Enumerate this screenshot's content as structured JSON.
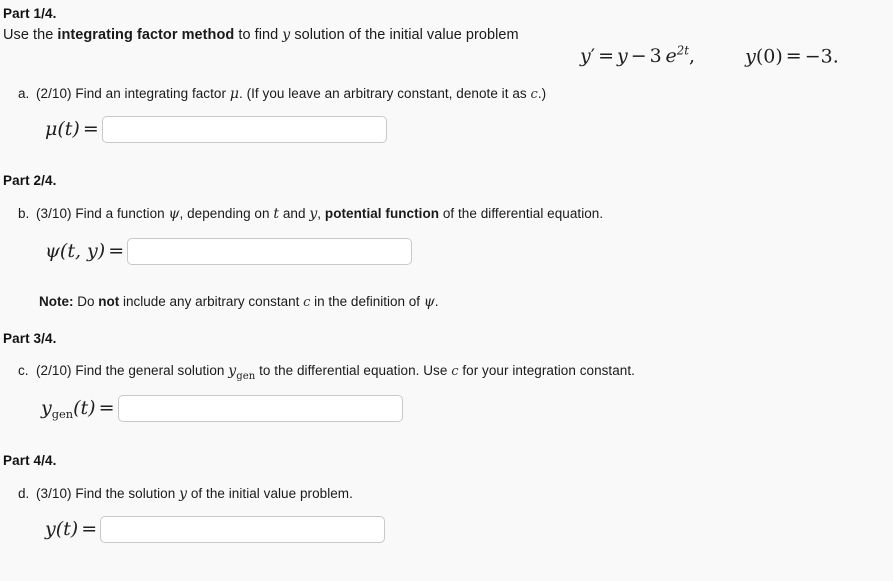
{
  "page": {
    "background_color": "#f9f9f9",
    "text_color": "#1a1a1a"
  },
  "parts": [
    {
      "heading": "Part 1/4.",
      "prompt": {
        "before_bold": "Use the ",
        "bold": "integrating factor method",
        "after_bold": " to find ",
        "math_var": "y",
        "tail": " solution of the initial value problem"
      },
      "equation": {
        "left": "y′ = y − 3 e",
        "exponent": "2t",
        "comma": ",",
        "initial_condition": "y(0) = −3."
      },
      "item": {
        "marker": "a.",
        "points": "(2/10)",
        "text_1": " Find an integrating factor ",
        "math_1": "μ",
        "text_2": ". (If you leave an arbitrary constant, denote it as ",
        "math_2": "c",
        "text_3": ".)"
      },
      "answer": {
        "label_fn": "μ",
        "label_args": "(t)",
        "label_eq": "=",
        "value": "",
        "placeholder": ""
      }
    },
    {
      "heading": "Part 2/4.",
      "item": {
        "marker": "b.",
        "points": "(3/10)",
        "text_1": " Find a function ",
        "math_1": "ψ",
        "text_2": ", depending on ",
        "math_2": "t",
        "text_3": " and ",
        "math_3": "y",
        "text_4": ", ",
        "bold": "potential function",
        "text_5": " of the differential equation."
      },
      "answer": {
        "label_fn": "ψ",
        "label_args": "(t, y)",
        "label_eq": "=",
        "value": "",
        "placeholder": ""
      },
      "note": {
        "label": "Note:",
        "text_1": " Do ",
        "bold": "not",
        "text_2": " include any arbitrary constant ",
        "math_1": "c",
        "text_3": " in the definition of ",
        "math_2": "ψ",
        "text_4": "."
      }
    },
    {
      "heading": "Part 3/4.",
      "item": {
        "marker": "c.",
        "points": "(2/10)",
        "text_1": " Find the general solution ",
        "math_1": "y",
        "math_1_sub": "gen",
        "text_2": " to the differential equation. Use ",
        "math_2": "c",
        "text_3": " for your integration constant."
      },
      "answer": {
        "label_fn": "y",
        "label_sub": "gen",
        "label_args": "(t)",
        "label_eq": "=",
        "value": "",
        "placeholder": ""
      }
    },
    {
      "heading": "Part 4/4.",
      "item": {
        "marker": "d.",
        "points": "(3/10)",
        "text_1": " Find the solution ",
        "math_1": "y",
        "text_2": " of the initial value problem."
      },
      "answer": {
        "label_fn": "y",
        "label_args": "(t)",
        "label_eq": "=",
        "value": "",
        "placeholder": ""
      }
    }
  ]
}
